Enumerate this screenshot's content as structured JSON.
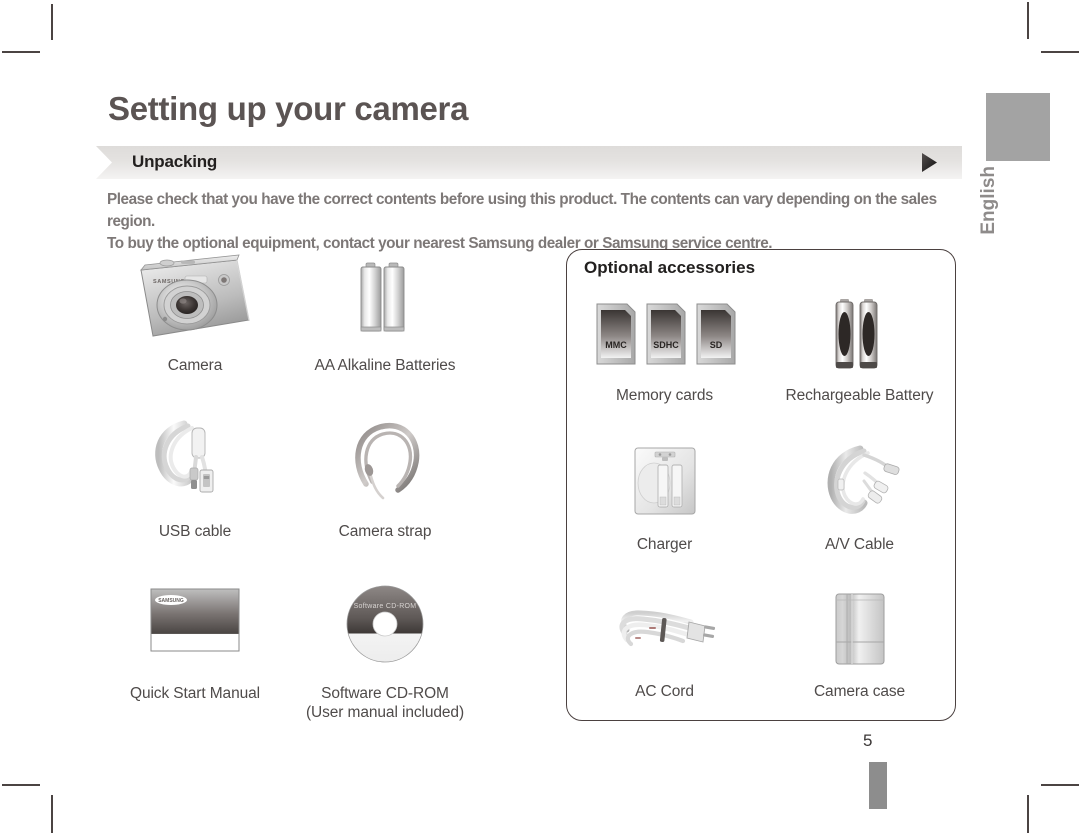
{
  "document": {
    "title": "Setting up your camera",
    "section_label": "Unpacking",
    "intro_line_1": "Please check that you have the correct contents before using this product. The contents can vary depending on the sales region.",
    "intro_line_2": "To buy the optional equipment, contact your nearest Samsung dealer or Samsung service centre.",
    "page_number": "5",
    "language_tab": "English",
    "brand": "SAMSUNG"
  },
  "standard_items": [
    {
      "caption": "Camera",
      "sub": "",
      "icon": "camera-icon"
    },
    {
      "caption": "AA Alkaline Batteries",
      "sub": "",
      "icon": "aa-batteries-icon"
    },
    {
      "caption": "USB cable",
      "sub": "",
      "icon": "usb-cable-icon"
    },
    {
      "caption": "Camera strap",
      "sub": "",
      "icon": "camera-strap-icon"
    },
    {
      "caption": "Quick Start Manual",
      "sub": "",
      "icon": "quick-start-manual-icon"
    },
    {
      "caption": "Software CD-ROM",
      "sub": "(User manual included)",
      "icon": "software-cd-rom-icon"
    }
  ],
  "optional_panel": {
    "title": "Optional accessories",
    "items": [
      {
        "caption": "Memory cards",
        "icon": "memory-cards-icon"
      },
      {
        "caption": "Rechargeable Battery",
        "icon": "rechargeable-battery-icon"
      },
      {
        "caption": "Charger",
        "icon": "charger-icon"
      },
      {
        "caption": "A/V Cable",
        "icon": "av-cable-icon"
      },
      {
        "caption": "AC Cord",
        "icon": "ac-cord-icon"
      },
      {
        "caption": "Camera case",
        "icon": "camera-case-icon"
      }
    ]
  },
  "memory_card_labels": [
    "MMC",
    "SDHC",
    "SD"
  ],
  "cd_label": "Software CD-ROM",
  "colors": {
    "title": "#5b5453",
    "body_text": "#7d7877",
    "caption": "#4f4b4a",
    "banner_start": "#d9d7d5",
    "banner_end": "#efeeec",
    "panel_border": "#4b4140",
    "tab_fill": "#a3a3a3",
    "footer_bar": "#8d8d8d"
  }
}
